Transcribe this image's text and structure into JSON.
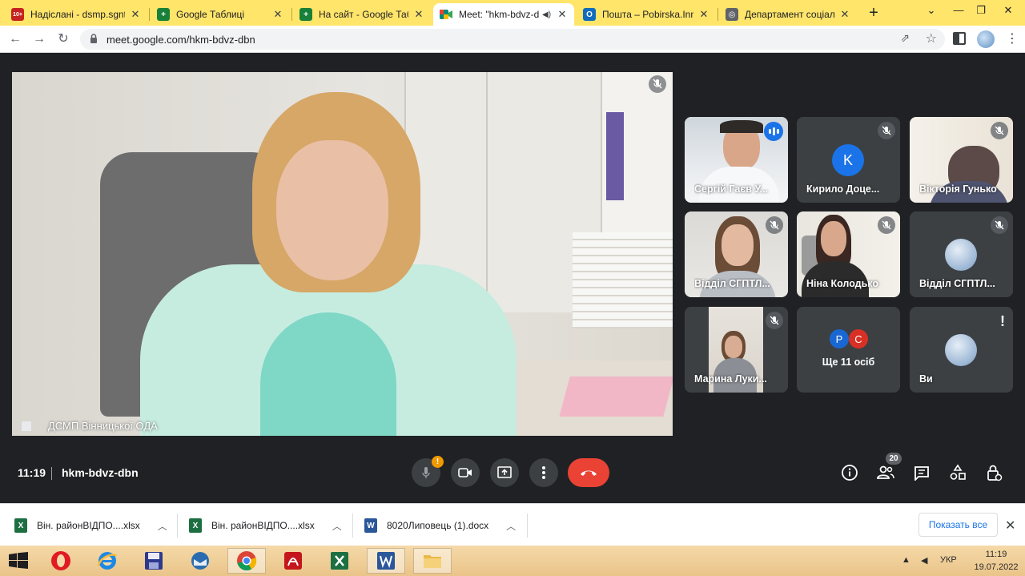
{
  "browser": {
    "tabs": [
      {
        "label": "Надіслані - dsmp.sgnt@",
        "icon": "mail-icon",
        "color": "#c5221f"
      },
      {
        "label": "Google Таблиці",
        "icon": "sheets-icon",
        "color": "#188038"
      },
      {
        "label": "На сайт - Google Табли",
        "icon": "sheets-icon",
        "color": "#188038"
      },
      {
        "label": "Meet: \"hkm-bdvz-d",
        "icon": "meet-icon",
        "color": "#00897b",
        "active": true
      },
      {
        "label": "Пошта – Pobirska.Inna@",
        "icon": "outlook-icon",
        "color": "#0f6cbd"
      },
      {
        "label": "Департамент соціальн",
        "icon": "website-icon",
        "color": "#3c4043"
      }
    ],
    "fav_texts": {
      "mail": "10+",
      "sheets": "+",
      "outlook": "O",
      "site": "◎"
    },
    "url": "meet.google.com/hkm-bdvz-dbn"
  },
  "meet": {
    "main": {
      "name": "ДСМП Вінницької ОДА"
    },
    "tiles": [
      {
        "name": "Сергій Гаєв У...",
        "state": "speaking"
      },
      {
        "name": "Кирило Доце...",
        "avatar_letter": "K",
        "avatar_color": "#1a73e8"
      },
      {
        "name": "Вікторія Гунько"
      },
      {
        "name": "Відділ СГПТЛ..."
      },
      {
        "name": "Ніна Колодько"
      },
      {
        "name": "Відділ СГПТЛ..."
      },
      {
        "name": "Марина Луки..."
      },
      {
        "name": "Ще 11 осіб",
        "chips": [
          "P",
          "C"
        ],
        "chip_colors": [
          "#1967d2",
          "#d93025"
        ]
      },
      {
        "name": "Ви"
      }
    ],
    "time": "11:19",
    "code": "hkm-bdvz-dbn",
    "mic_badge": "!",
    "people_count": "20",
    "alert_mark": "!"
  },
  "downloads": {
    "items": [
      {
        "name": "Він. районВІДПО....xlsx",
        "type": "excel"
      },
      {
        "name": "Він. районВІДПО....xlsx",
        "type": "excel"
      },
      {
        "name": "8020Липовець (1).docx",
        "type": "word"
      }
    ],
    "file_letters": {
      "excel": "X",
      "word": "W"
    },
    "show_all": "Показать все"
  },
  "taskbar": {
    "lang": "УКР",
    "time": "11:19",
    "date": "19.07.2022"
  },
  "colors": {
    "accent": "#1a73e8",
    "end_call": "#ea4335",
    "meet_bg": "#202124",
    "tile_bg": "#3c4043"
  }
}
